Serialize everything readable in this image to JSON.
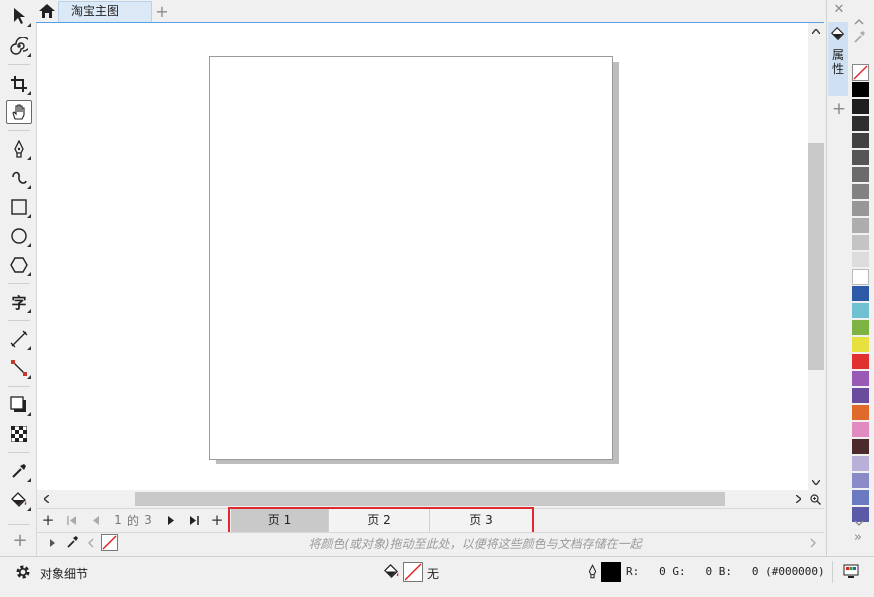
{
  "tabs": {
    "home_icon": "home-icon",
    "document_tab": "淘宝主图",
    "new_tab": "+"
  },
  "toolbox": {
    "tools": [
      {
        "name": "pick-tool-icon"
      },
      {
        "name": "spiral-tool-icon"
      },
      {
        "name": "crop-tool-icon"
      },
      {
        "name": "pan-tool-icon",
        "active": true
      },
      {
        "name": "pen-tool-icon"
      },
      {
        "name": "freehand-tool-icon"
      },
      {
        "name": "rectangle-tool-icon"
      },
      {
        "name": "ellipse-tool-icon"
      },
      {
        "name": "polygon-tool-icon"
      },
      {
        "name": "text-tool-icon",
        "glyph": "字"
      },
      {
        "name": "dimension-tool-icon"
      },
      {
        "name": "connector-tool-icon"
      },
      {
        "name": "shadow-tool-icon"
      },
      {
        "name": "transparency-tool-icon"
      },
      {
        "name": "eyedropper-tool-icon"
      },
      {
        "name": "fill-tool-icon"
      }
    ],
    "add_button": "+"
  },
  "page_navigator": {
    "add_page": "+",
    "current": "1",
    "of": "的",
    "total": "3",
    "add_page_after": "+",
    "pages": [
      "页 1",
      "页 2",
      "页 3"
    ]
  },
  "document_palette": {
    "hint": "将颜色(或对象)拖动至此处，以便将这些颜色与文档存储在一起"
  },
  "status_bar": {
    "object_details": "对象细节",
    "fill_value": "无",
    "outline_color": "R:   0 G:   0 B:   0 (#000000)"
  },
  "docker": {
    "properties_label": "属性",
    "add": "+"
  },
  "palette": {
    "colors": [
      "#000000",
      "#1e1e1e",
      "#2e2e2e",
      "#414141",
      "#555555",
      "#6b6b6b",
      "#818181",
      "#979797",
      "#adadad",
      "#c4c4c4",
      "#dcdcdc",
      "#ffffff",
      "#2d5aa6",
      "#6fc1d1",
      "#7cb342",
      "#e6e040",
      "#e03030",
      "#9b59b6",
      "#6b4b9e",
      "#e06a2a",
      "#e28bc0",
      "#4a2a2a",
      "#b8b0d8",
      "#8a8ac8",
      "#6a7ac0",
      "#5a5aa8"
    ]
  }
}
